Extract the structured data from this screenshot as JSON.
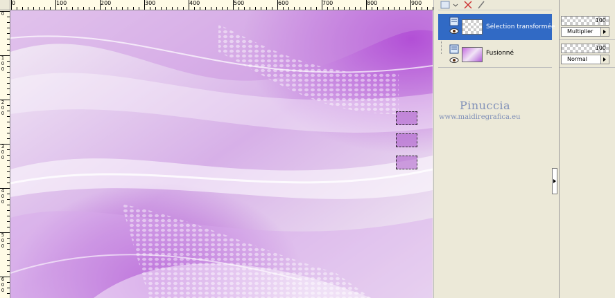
{
  "ruler": {
    "top_labels": [
      "0",
      "100",
      "200",
      "300",
      "400",
      "500",
      "600",
      "700",
      "800",
      "900"
    ],
    "left_labels": [
      [
        "0"
      ],
      [
        "1",
        "0",
        "0"
      ],
      [
        "2",
        "0",
        "0"
      ],
      [
        "3",
        "0",
        "0"
      ],
      [
        "4",
        "0",
        "0"
      ],
      [
        "5",
        "0",
        "0"
      ],
      [
        "6",
        "0",
        "0"
      ]
    ]
  },
  "layers": [
    {
      "name": "Sélection transformée",
      "selected": true,
      "thumbnail": "transparent-checker"
    },
    {
      "name": "Fusionné",
      "selected": false,
      "thumbnail": "purple-waves"
    }
  ],
  "properties": [
    {
      "opacity": "100",
      "blend_mode": "Multiplier"
    },
    {
      "opacity": "100",
      "blend_mode": "Normal"
    }
  ],
  "watermark": {
    "title": "Pinuccia",
    "url": "www.maidiregrafica.eu"
  },
  "colors": {
    "selection_highlight": "#316ac5",
    "panel_bg": "#ece9d8",
    "canvas_accent": "#b66bd6"
  },
  "icons": [
    "eye-icon",
    "layer-icon",
    "chevron-right-icon"
  ]
}
